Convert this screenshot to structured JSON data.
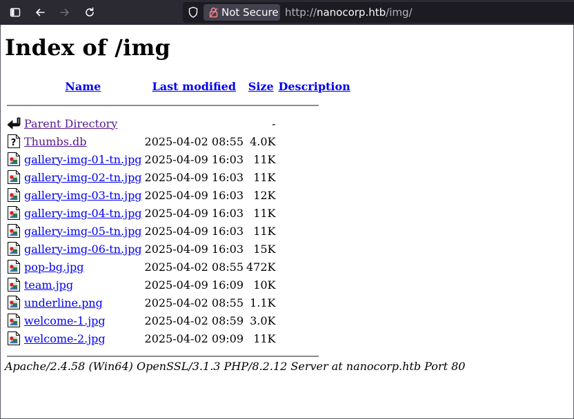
{
  "browser": {
    "security_label": "Not Secure",
    "url_prefix": "http://",
    "url_host": "nanocorp.htb",
    "url_path": "/img/",
    "icons": [
      "sidebar-icon",
      "back-icon",
      "forward-icon",
      "reload-icon",
      "shield-icon",
      "lock-insecure-icon"
    ]
  },
  "page": {
    "title": "Index of /img",
    "columns": {
      "name": "Name",
      "last_modified": "Last modified",
      "size": "Size",
      "description": "Description"
    },
    "parent": {
      "name": "Parent Directory",
      "size": "-",
      "icon": "back-arrow-icon"
    },
    "files": [
      {
        "name": "Thumbs.db",
        "modified": "2025-04-02 08:55",
        "size": "4.0K",
        "icon": "unknown-file-icon",
        "visited": true
      },
      {
        "name": "gallery-img-01-tn.jpg",
        "modified": "2025-04-09 16:03",
        "size": "11K",
        "icon": "image-file-icon"
      },
      {
        "name": "gallery-img-02-tn.jpg",
        "modified": "2025-04-09 16:03",
        "size": "11K",
        "icon": "image-file-icon"
      },
      {
        "name": "gallery-img-03-tn.jpg",
        "modified": "2025-04-09 16:03",
        "size": "12K",
        "icon": "image-file-icon"
      },
      {
        "name": "gallery-img-04-tn.jpg",
        "modified": "2025-04-09 16:03",
        "size": "11K",
        "icon": "image-file-icon"
      },
      {
        "name": "gallery-img-05-tn.jpg",
        "modified": "2025-04-09 16:03",
        "size": "11K",
        "icon": "image-file-icon"
      },
      {
        "name": "gallery-img-06-tn.jpg",
        "modified": "2025-04-09 16:03",
        "size": "15K",
        "icon": "image-file-icon"
      },
      {
        "name": "pop-bg.jpg",
        "modified": "2025-04-02 08:55",
        "size": "472K",
        "icon": "image-file-icon"
      },
      {
        "name": "team.jpg",
        "modified": "2025-04-09 16:09",
        "size": "10K",
        "icon": "image-file-icon"
      },
      {
        "name": "underline.png",
        "modified": "2025-04-02 08:55",
        "size": "1.1K",
        "icon": "image-file-icon"
      },
      {
        "name": "welcome-1.jpg",
        "modified": "2025-04-02 08:59",
        "size": "3.0K",
        "icon": "image-file-icon"
      },
      {
        "name": "welcome-2.jpg",
        "modified": "2025-04-02 09:09",
        "size": "11K",
        "icon": "image-file-icon"
      }
    ],
    "server_signature": "Apache/2.4.58 (Win64) OpenSSL/3.1.3 PHP/8.2.12 Server at nanocorp.htb Port 80"
  },
  "colors": {
    "link": "#0000ee",
    "visited_link": "#551a8b",
    "toolbar_bg": "#2b2a33",
    "urlbar_bg": "#1c1b22"
  }
}
